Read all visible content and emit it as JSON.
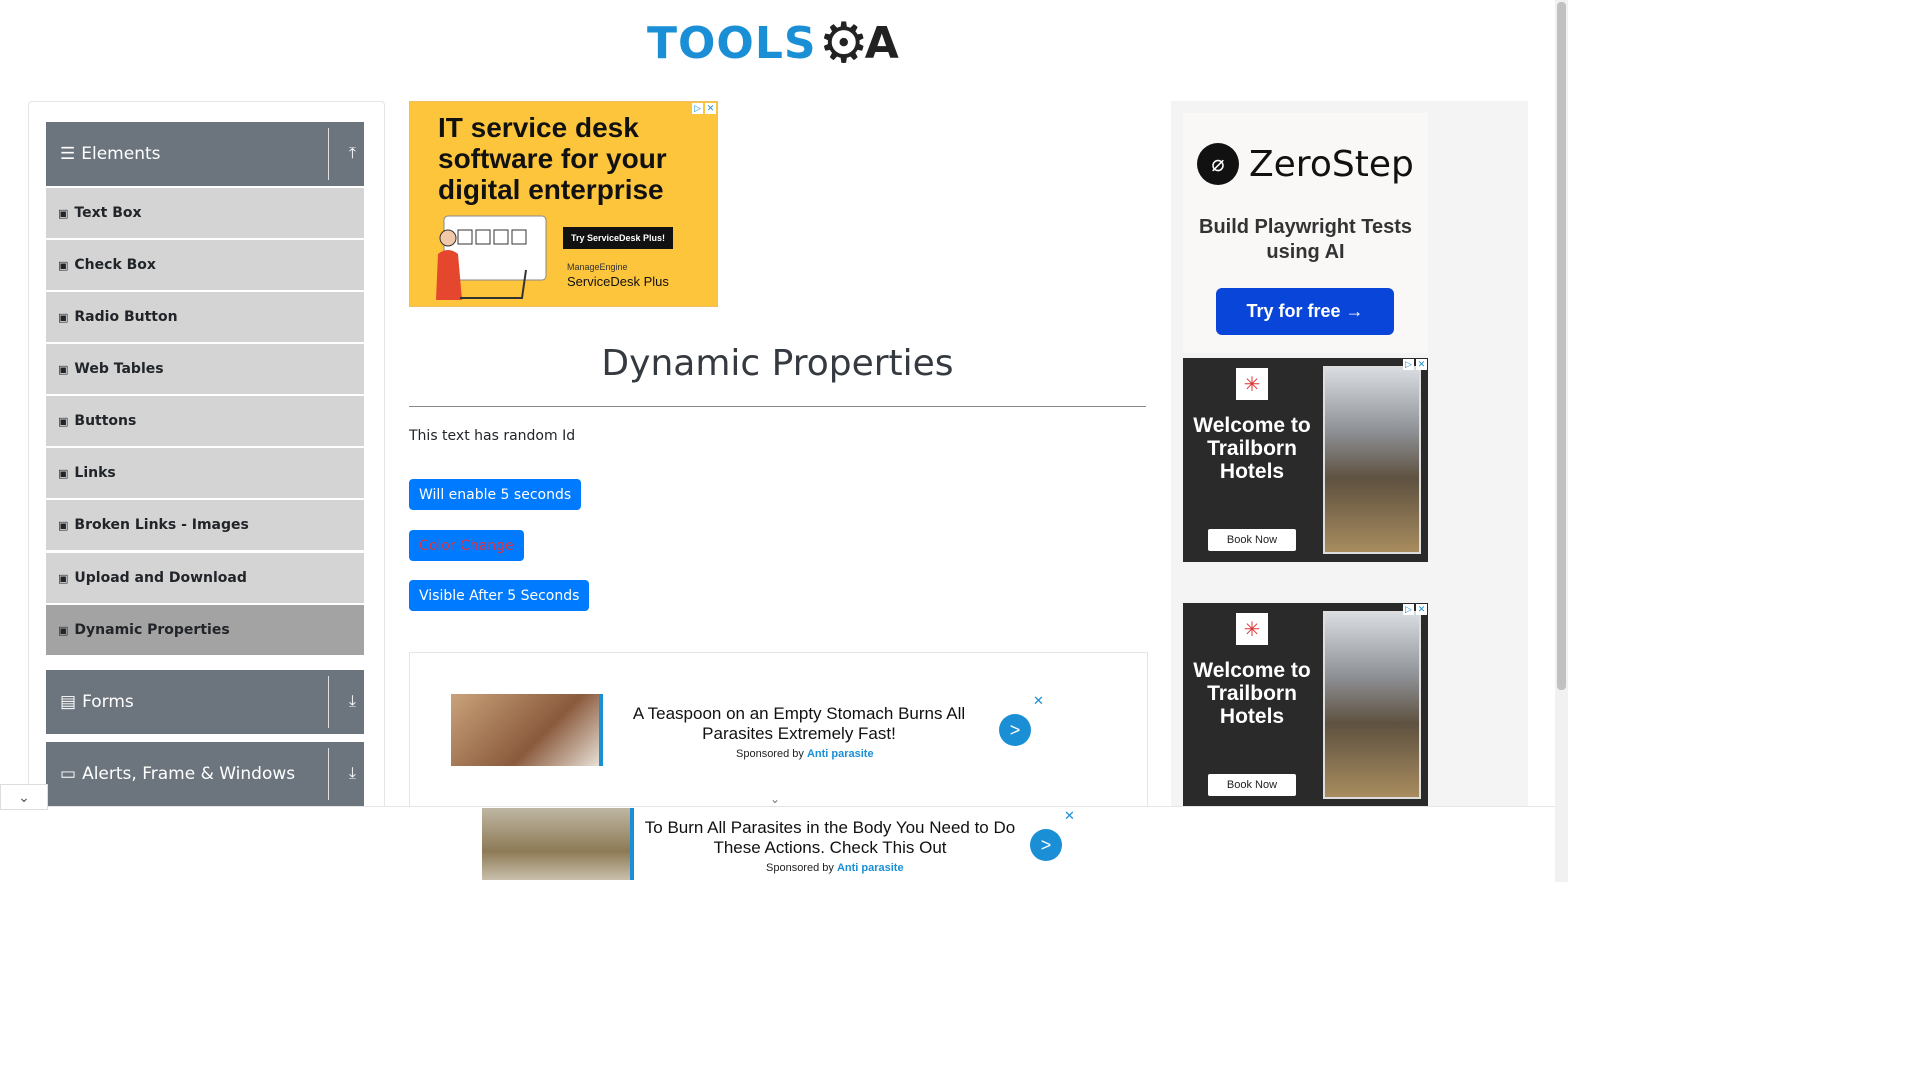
{
  "logo": {
    "text": "TOOLS",
    "gear": "gear-icon",
    "suffix": "A"
  },
  "sidebar": {
    "groups": [
      {
        "label": "Elements",
        "icon": "hamburger-icon",
        "arrow": "collapse-arrow-icon"
      },
      {
        "label": "Forms",
        "icon": "form-icon",
        "arrow": "expand-arrow-icon"
      },
      {
        "label": "Alerts, Frame & Windows",
        "icon": "window-icon",
        "arrow": "expand-arrow-icon"
      }
    ],
    "items": [
      {
        "label": "Text Box"
      },
      {
        "label": "Check Box"
      },
      {
        "label": "Radio Button"
      },
      {
        "label": "Web Tables"
      },
      {
        "label": "Buttons"
      },
      {
        "label": "Links"
      },
      {
        "label": "Broken Links - Images"
      },
      {
        "label": "Upload and Download"
      },
      {
        "label": "Dynamic Properties"
      }
    ],
    "active_item": "Dynamic Properties"
  },
  "ad_top": {
    "headline": "IT service desk software for your digital enterprise",
    "cta": "Try ServiceDesk Plus!",
    "brand_small": "ManageEngine",
    "brand_large": "ServiceDesk Plus",
    "bg_color": "#fdc53c"
  },
  "main": {
    "title": "Dynamic Properties",
    "random_text": "This text has random Id",
    "btn_enable": "Will enable 5 seconds",
    "btn_color": "Color Change",
    "btn_visible": "Visible After 5 Seconds",
    "accent": "#007bff",
    "color_change_text": "#dc3545"
  },
  "native_ad": {
    "headline": "A Teaspoon on an Empty Stomach Burns All Parasites Extremely Fast!",
    "sponsored_prefix": "Sponsored by",
    "sponsor": "Anti parasite",
    "go": ">",
    "close": "✕"
  },
  "bottom_ad": {
    "headline": "To Burn All Parasites in the Body You Need to Do These Actions. Check This Out",
    "sponsored_prefix": "Sponsored by",
    "sponsor": "Anti parasite",
    "go": ">",
    "close": "✕"
  },
  "right_ads": {
    "zerostep": {
      "name": "ZeroStep",
      "tagline": "Build Playwright Tests using AI",
      "cta": "Try for free →"
    },
    "hotel": {
      "text": "Welcome to Trailborn Hotels",
      "cta": "Book Now"
    }
  }
}
